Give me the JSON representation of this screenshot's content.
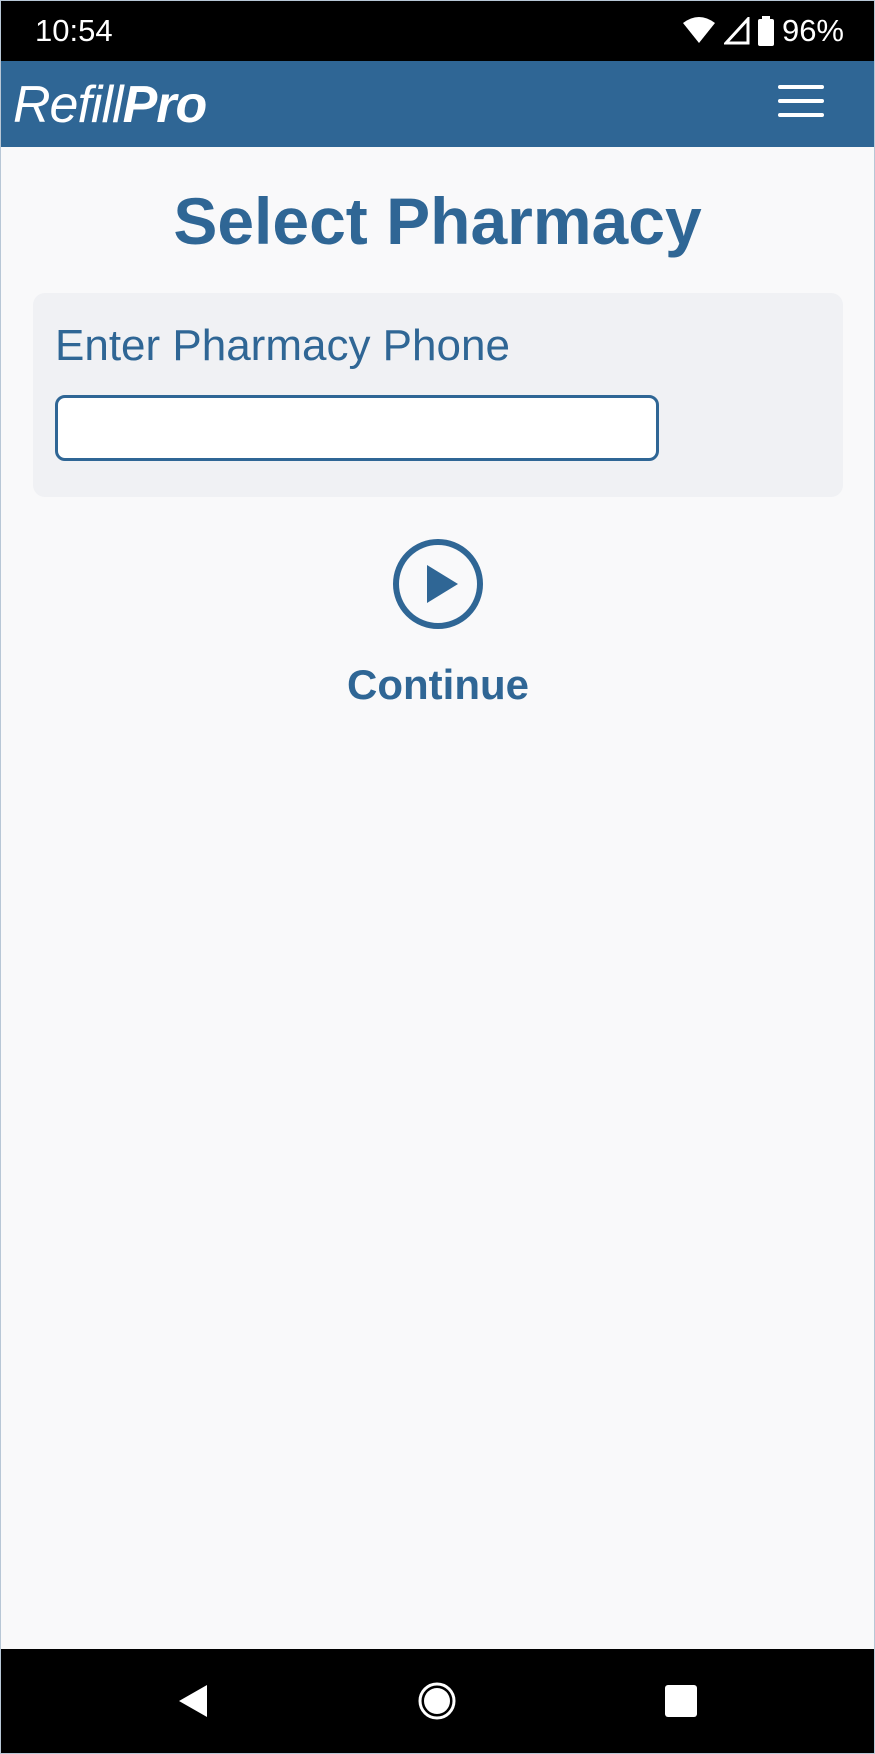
{
  "status_bar": {
    "time": "10:54",
    "battery": "96%",
    "icons": [
      "wifi-icon",
      "signal-icon",
      "battery-icon"
    ]
  },
  "header": {
    "brand_part1": "Refill",
    "brand_part2": "Pro",
    "menu_icon": "hamburger-menu-icon",
    "color": "#2f6695"
  },
  "main": {
    "title": "Select Pharmacy",
    "phone_label": "Enter Pharmacy Phone",
    "phone_value": "",
    "phone_placeholder": "",
    "continue_label": "Continue",
    "continue_icon": "play-circle-icon"
  },
  "nav_bar": {
    "icons": [
      "back-icon",
      "home-icon",
      "recents-icon"
    ]
  }
}
